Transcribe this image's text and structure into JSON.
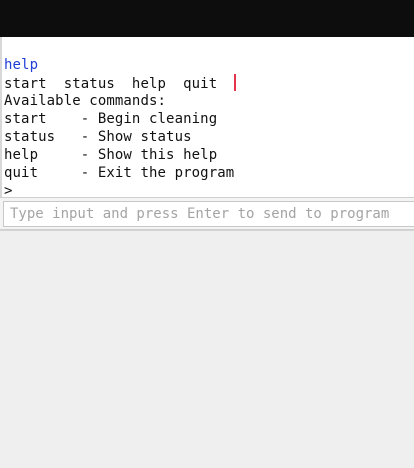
{
  "console": {
    "lines": [
      {
        "text": "help"
      },
      {
        "text": "start  status  help  quit "
      },
      {
        "text": "Available commands:"
      },
      {
        "text": "start    - Begin cleaning"
      },
      {
        "text": "status   - Show status"
      },
      {
        "text": "help     - Show this help"
      },
      {
        "text": "quit     - Exit the program"
      },
      {
        "text": ">"
      }
    ],
    "echo_color": "#1f3fd6",
    "cursor_color": "#e5344b"
  },
  "input": {
    "placeholder": "Type input and press Enter to send to program",
    "value": ""
  }
}
